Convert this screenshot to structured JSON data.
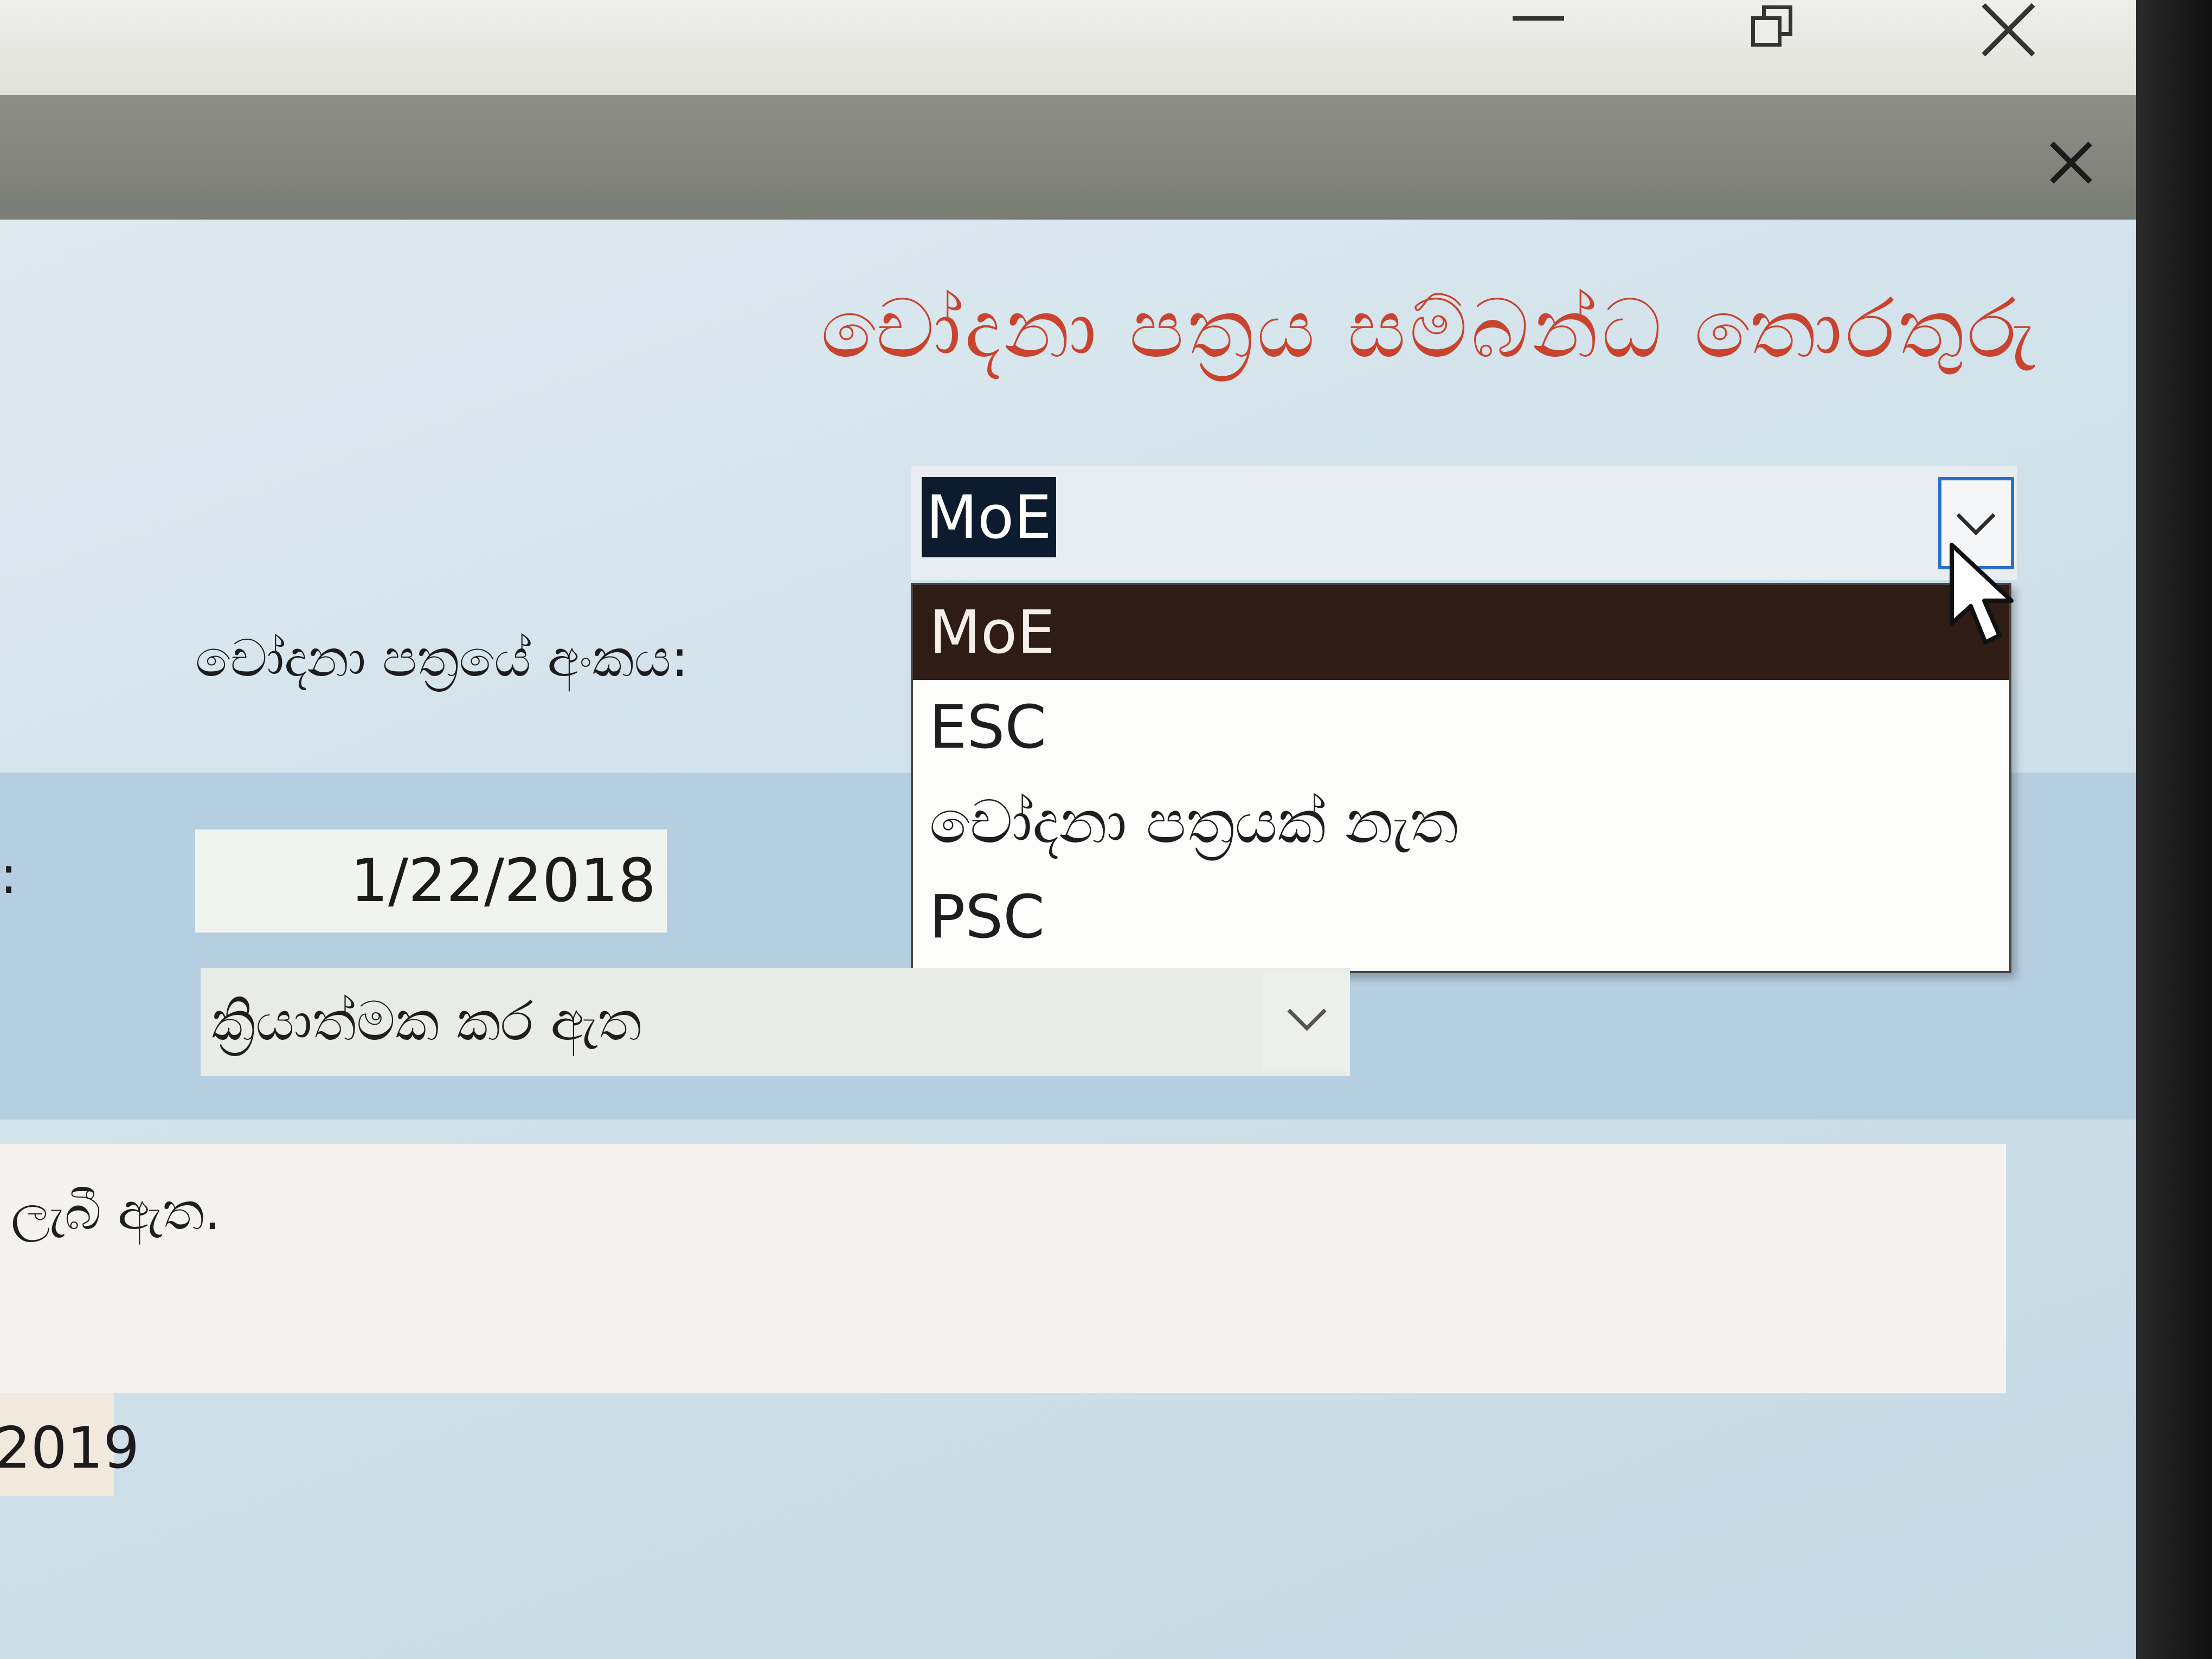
{
  "window": {
    "minimize_label": "—",
    "close_label": "✕"
  },
  "form": {
    "title": "චෝදනා පත්‍රය සම්බන්ධ තොරතුරු",
    "paper_number_label": "චෝදනා පත්‍රයේ අංකය:",
    "colon_label": ":",
    "paper_number_combo": {
      "selected": "MoE",
      "options": [
        "MoE",
        "ESC",
        "චෝදනා පත්‍රයක් නැත",
        "PSC"
      ],
      "highlighted_index": 0
    },
    "date_value": "1/22/2018",
    "status_value": "ක්‍රියාත්මක කර ඇත",
    "notes_value": "ලැබී ඇත.",
    "year_value": "2019"
  },
  "colors": {
    "title": "#c8442e",
    "selection_bg": "#0d1b2e",
    "dropdown_highlight": "#2e1c15",
    "form_bg": "#d2e2eb",
    "band_bg": "#b6cfe0",
    "header_bar": "#7f817b"
  },
  "icons": {
    "minimize": "minimize-icon",
    "restore": "restore-icon",
    "close": "close-icon",
    "form_close": "close-icon",
    "dropdown": "chevron-down-icon",
    "cursor": "mouse-pointer-icon"
  }
}
